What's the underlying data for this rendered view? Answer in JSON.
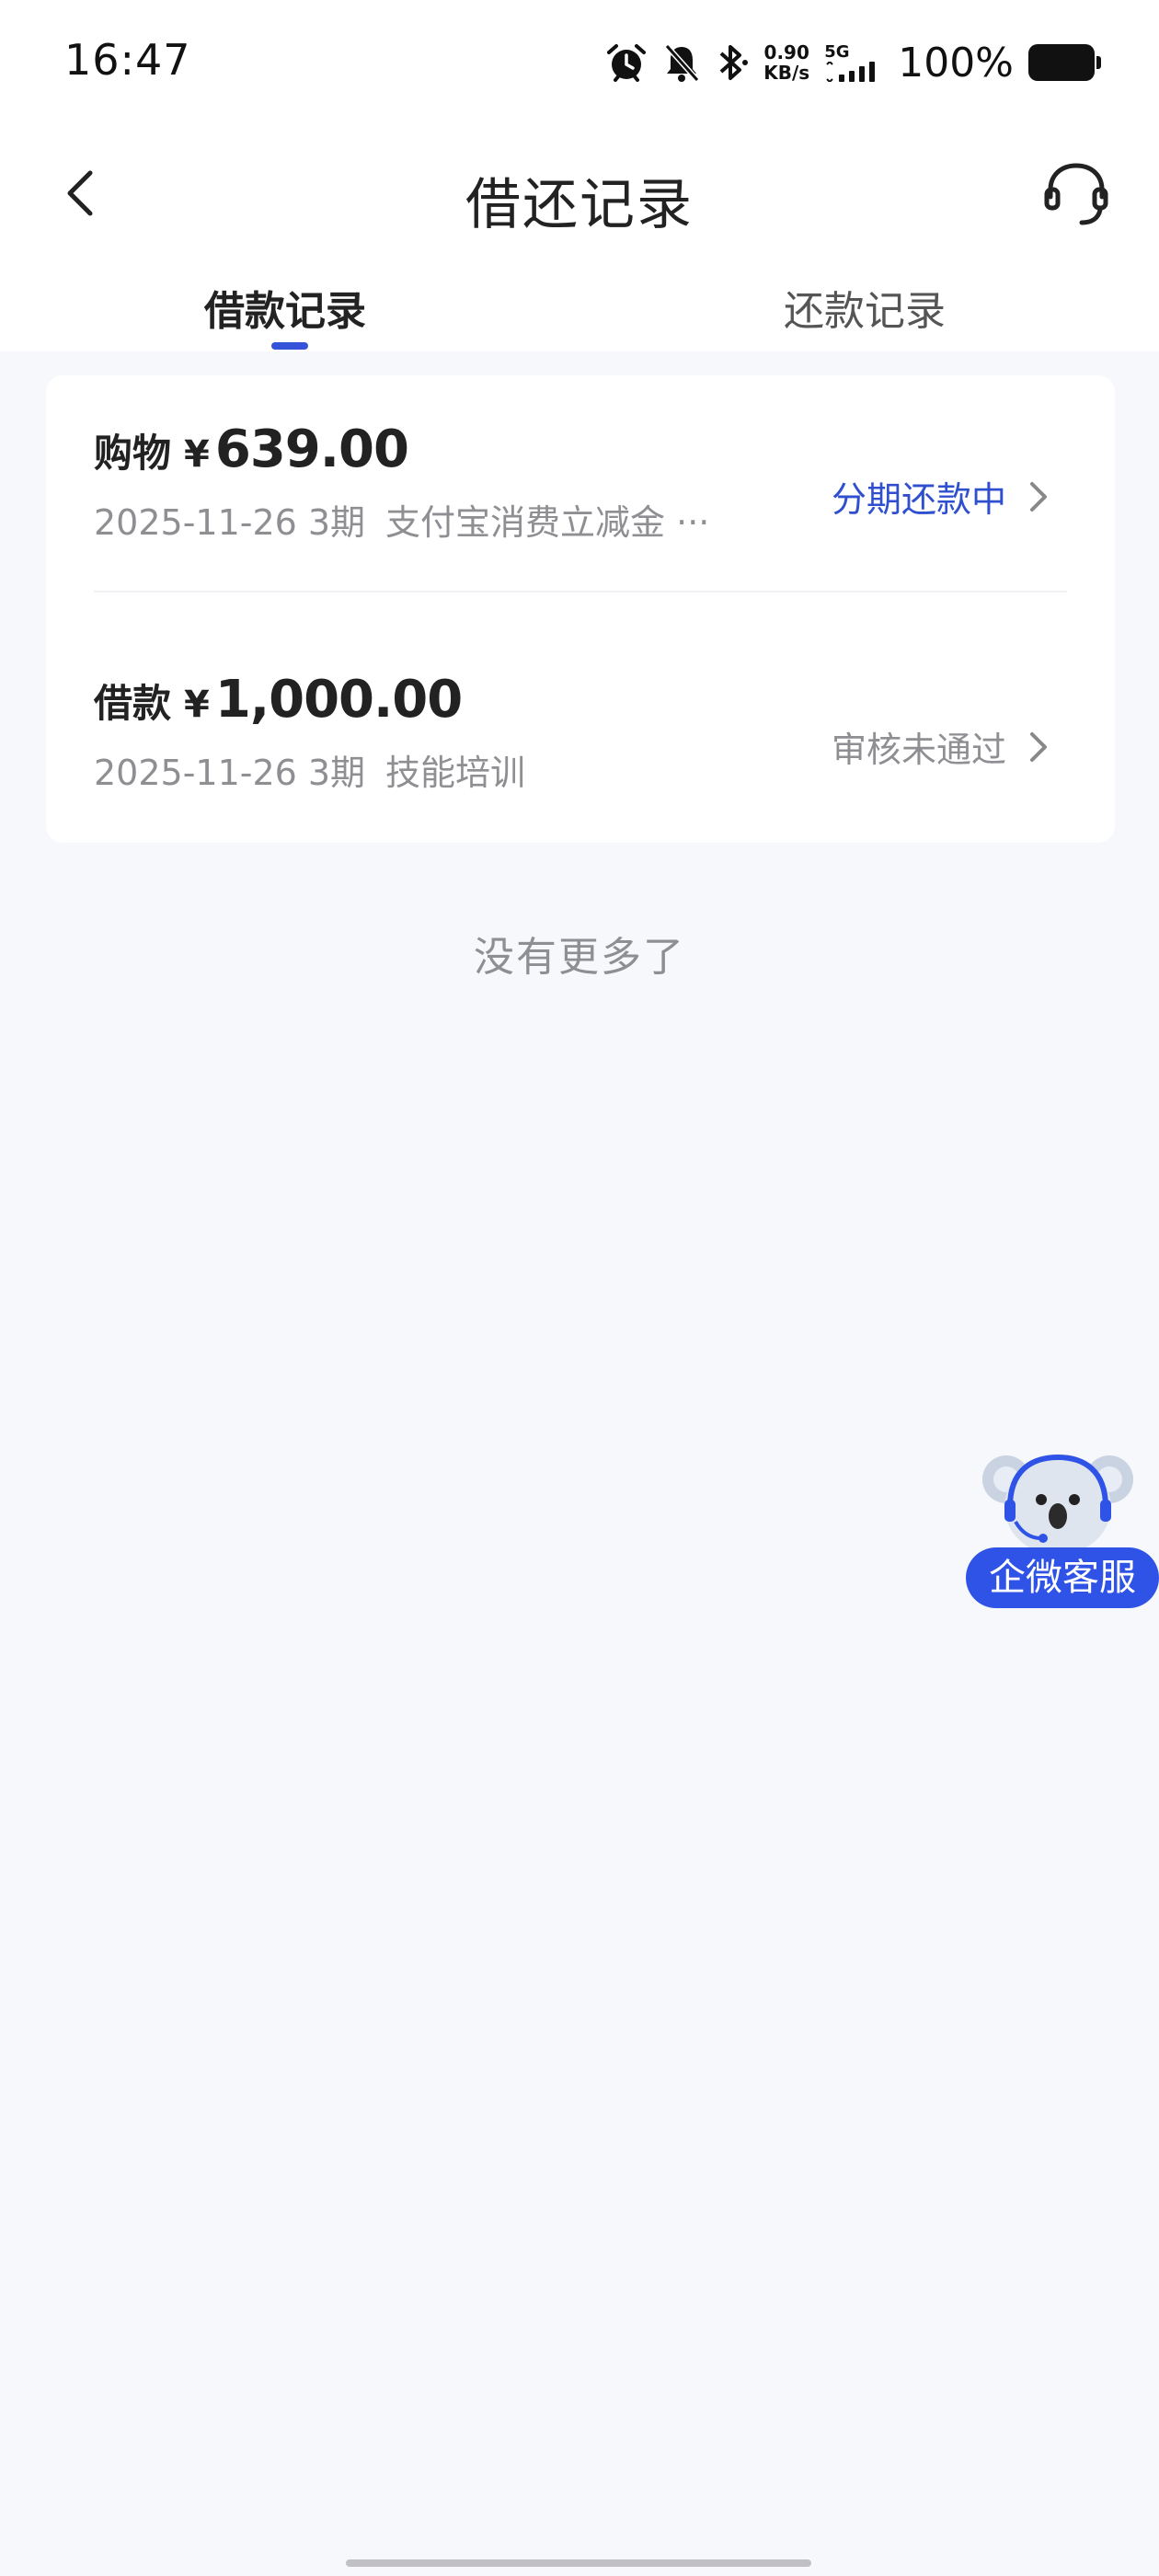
{
  "status_bar": {
    "time": "16:47",
    "net_speed_value": "0.90",
    "net_speed_unit": "KB/s",
    "network_type": "5G",
    "battery_percent": "100%",
    "icons": [
      "alarm-icon",
      "mute-bell-icon",
      "bluetooth-icon",
      "signal-icon",
      "battery-icon"
    ]
  },
  "header": {
    "title": "借还记录",
    "back_icon": "chevron-left-icon",
    "support_icon": "headset-icon"
  },
  "tabs": [
    {
      "label": "借款记录",
      "active": true
    },
    {
      "label": "还款记录",
      "active": false
    }
  ],
  "records": [
    {
      "kind": "购物",
      "currency": "¥",
      "amount": "639.00",
      "date": "2025-11-26",
      "term": "3期",
      "purpose": "支付宝消费立减金 ···",
      "status": "分期还款中",
      "status_color": "#2f4fcf"
    },
    {
      "kind": "借款",
      "currency": "¥",
      "amount": "1,000.00",
      "date": "2025-11-26",
      "term": "3期",
      "purpose": "技能培训",
      "status": "审核未通过",
      "status_color": "#8e8e93"
    }
  ],
  "footer_note": "没有更多了",
  "floating_service": {
    "label": "企微客服",
    "icon": "koala-mascot-icon"
  },
  "colors": {
    "accent": "#2f4fcf",
    "background": "#f7f8fc",
    "service_button": "#2f53e6"
  }
}
